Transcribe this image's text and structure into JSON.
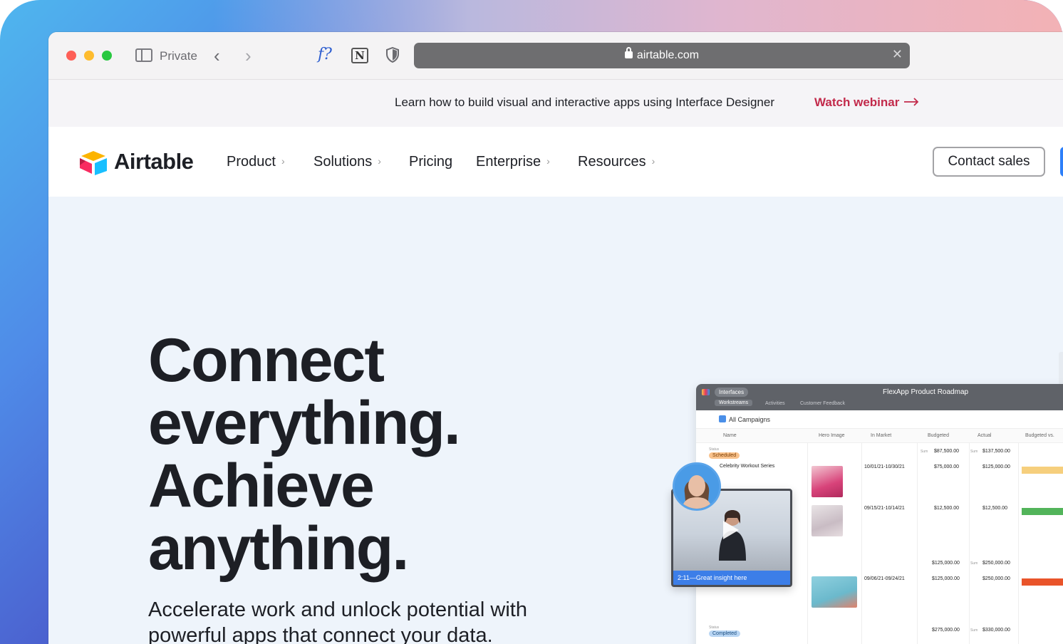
{
  "browser": {
    "private_label": "Private",
    "url": "airtable.com",
    "icons": [
      "sidebar-toggle-icon",
      "back-chevron-icon",
      "forward-chevron-icon",
      "formula-extension-icon",
      "notion-extension-icon",
      "shield-icon",
      "lock-icon",
      "close-icon"
    ]
  },
  "banner": {
    "text": "Learn how to build visual and interactive apps using Interface Designer",
    "link": "Watch webinar",
    "link_color": "#c22a4b"
  },
  "nav": {
    "logo_text": "Airtable",
    "items": [
      {
        "label": "Product",
        "has_chevron": true
      },
      {
        "label": "Solutions",
        "has_chevron": true
      },
      {
        "label": "Pricing",
        "has_chevron": false
      },
      {
        "label": "Enterprise",
        "has_chevron": true
      },
      {
        "label": "Resources",
        "has_chevron": true
      }
    ],
    "contact_label": "Contact sales",
    "accent": "#2d7ff9"
  },
  "hero": {
    "title_lines": [
      "Connect",
      "everything.",
      "Achieve",
      "anything."
    ],
    "subtitle_line1": "Accelerate work and unlock potential with",
    "subtitle_line2": "powerful apps that connect your data.",
    "background": "#eef4fb"
  },
  "preview": {
    "chip": "Interfaces",
    "title": "FlexApp Product Roadmap",
    "tabs": [
      "Workstreams",
      "Activities",
      "Customer Feedback"
    ],
    "view": "All Campaigns",
    "columns": [
      "Name",
      "Hero Image",
      "In Market",
      "Budgeted",
      "Actual",
      "Budgeted vs."
    ],
    "groups": {
      "scheduled": "Scheduled",
      "completed": "Completed",
      "status_label": "Status"
    },
    "summary_label": "Sum",
    "rows": [
      {
        "sum_budgeted": "$87,500.00",
        "sum_actual": "$137,500.00"
      },
      {
        "name": "Celebrity Workout Series",
        "in_market": "10/01/21-10/30/21",
        "budgeted": "$75,000.00",
        "actual": "$125,000.00",
        "bar_color": "#f6cf7d"
      },
      {
        "in_market": "09/15/21-10/14/21",
        "budgeted": "$12,500.00",
        "actual": "$12,500.00",
        "bar_color": "#52b45a"
      },
      {
        "sum_budgeted": "$125,000.00",
        "sum_actual": "$250,000.00"
      },
      {
        "in_market": "09/06/21-09/24/21",
        "budgeted": "$125,000.00",
        "actual": "$250,000.00",
        "bar_color": "#e9542a"
      },
      {
        "sum_budgeted": "$275,000.00",
        "sum_actual": "$330,000.00"
      }
    ],
    "video_caption": "2:11—Great insight here"
  }
}
